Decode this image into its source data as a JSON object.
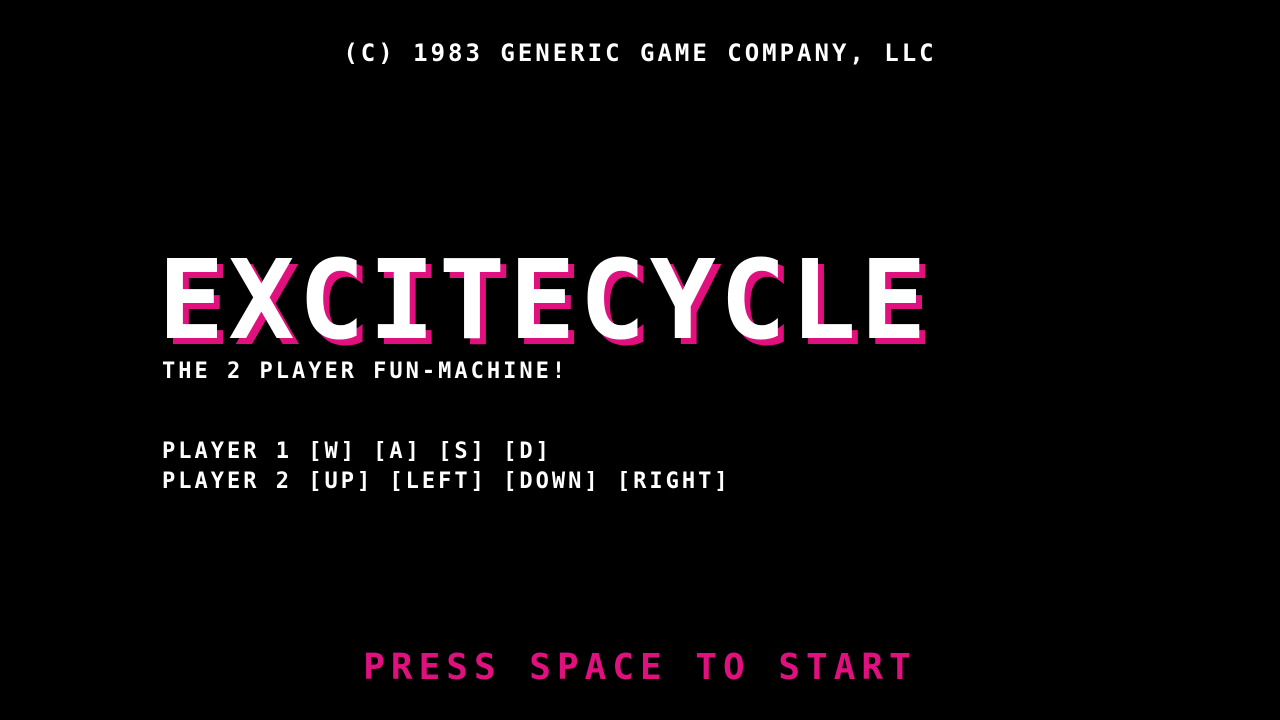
{
  "screen": {
    "copyright": "(C) 1983 GENERIC GAME COMPANY, LLC",
    "title": "EXCITECYCLE",
    "subtitle": "THE 2 PLAYER FUN-MACHINE!",
    "controls": [
      {
        "text": "PLAYER 1 [W] [A] [S] [D]"
      },
      {
        "text": "PLAYER 2 [UP] [LEFT] [DOWN] [RIGHT]"
      }
    ],
    "prompt": "PRESS SPACE TO START"
  },
  "colors": {
    "background": "#000000",
    "text": "#ffffff",
    "accent": "#e0117f"
  }
}
